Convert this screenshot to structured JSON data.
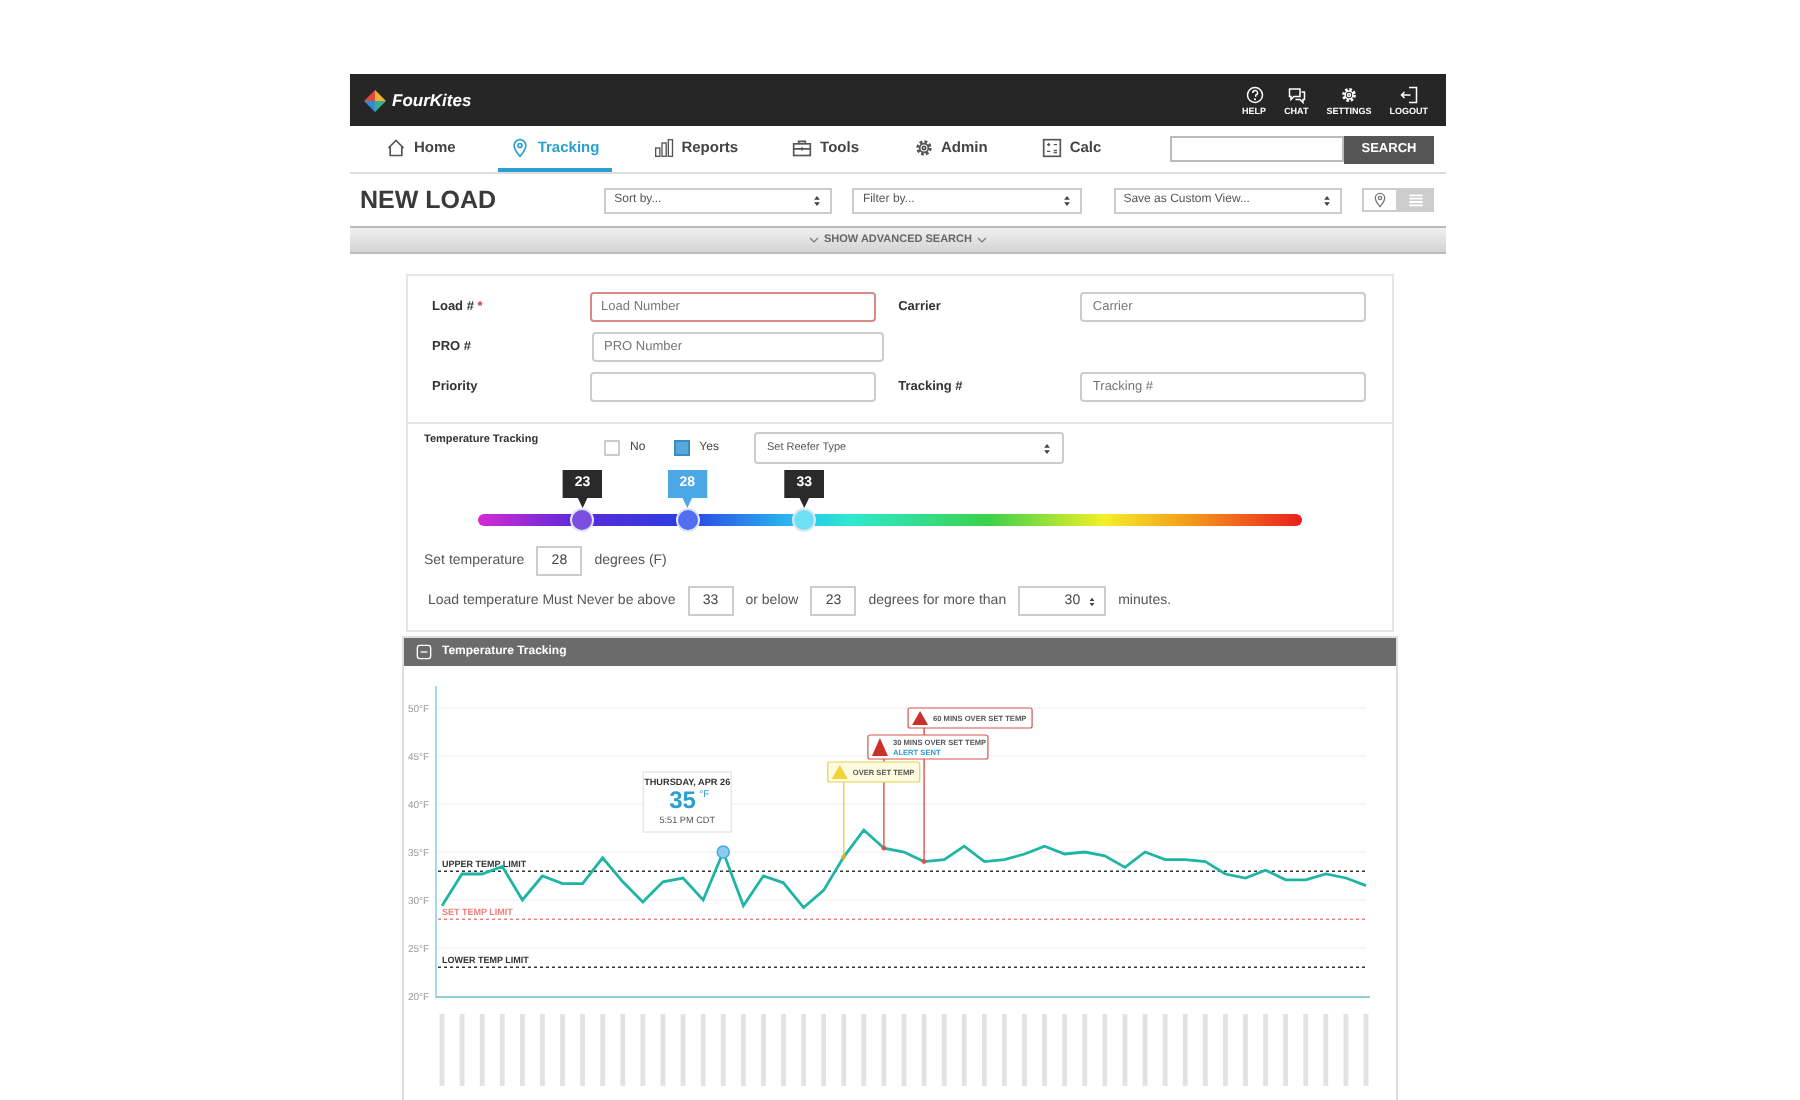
{
  "header": {
    "logo": "FourKites",
    "actions": [
      {
        "label": "HELP"
      },
      {
        "label": "CHAT"
      },
      {
        "label": "SETTINGS"
      },
      {
        "label": "LOGOUT"
      }
    ]
  },
  "nav": {
    "tabs": [
      {
        "label": "Home",
        "selected": false
      },
      {
        "label": "Tracking",
        "selected": true
      },
      {
        "label": "Reports",
        "selected": false
      },
      {
        "label": "Tools",
        "selected": false
      },
      {
        "label": "Admin",
        "selected": false
      },
      {
        "label": "Calc",
        "selected": false
      }
    ],
    "search_button": "SEARCH"
  },
  "toolbar": {
    "title": "NEW LOAD",
    "dropdowns": [
      "Sort by...",
      "Filter by...",
      "Save as Custom View..."
    ],
    "views": [
      {
        "selected": false
      },
      {
        "selected": true
      }
    ]
  },
  "advanced_search": "SHOW ADVANCED SEARCH",
  "form": {
    "rows": [
      [
        {
          "label": "Load #",
          "required_mark": "*",
          "placeholder": "Load Number",
          "invalid": true
        },
        {
          "label": "Carrier",
          "placeholder": "Carrier",
          "invalid": false
        }
      ],
      [
        {
          "label": "PRO #",
          "placeholder": "PRO Number",
          "invalid": false
        }
      ],
      [
        {
          "label": "Priority",
          "invalid": false
        },
        {
          "label": "Tracking #",
          "placeholder": "Tracking #",
          "invalid": false
        }
      ]
    ]
  },
  "temperature": {
    "title": "Temperature Tracking",
    "options": [
      {
        "label": "No",
        "checked": false
      },
      {
        "label": "Yes",
        "checked": true
      }
    ],
    "reefer_select": "Set Reefer Type",
    "thresholds": [
      {
        "value": "23",
        "level": 0.127,
        "selected": false,
        "color": "#7a4fe0"
      },
      {
        "value": "28",
        "level": 0.254,
        "selected": true,
        "color": "#4f6ff0"
      },
      {
        "value": "33",
        "level": 0.396,
        "selected": false,
        "color": "#6fe0f5"
      }
    ],
    "set_temp": {
      "label": "Set temperature",
      "value": "28",
      "unit": "degrees (F)"
    },
    "rule": [
      {
        "kind": "text",
        "text": "Load temperature Must Never be above"
      },
      {
        "kind": "input",
        "text": "33"
      },
      {
        "kind": "text",
        "text": "or below"
      },
      {
        "kind": "input",
        "text": "23"
      },
      {
        "kind": "text",
        "text": "degrees for more than"
      },
      {
        "kind": "spinner",
        "text": "30"
      },
      {
        "kind": "text",
        "text": "minutes."
      }
    ]
  },
  "chart_panel": {
    "title": "Temperature Tracking",
    "alerts": [
      {
        "kind": "warning",
        "label": "OVER SET TEMP"
      },
      {
        "kind": "critical",
        "label": "30 MINS OVER SET TEMP",
        "note": "ALERT SENT"
      },
      {
        "kind": "critical",
        "label": "60 MINS OVER SET TEMP"
      }
    ],
    "tooltip": {
      "title": "THURSDAY, APR 26",
      "value": "35",
      "unit": "°F",
      "time": "5:51 PM CDT"
    },
    "chart_data": {
      "type": "line",
      "grid": true,
      "ylim": [
        20,
        50
      ],
      "yticks": [
        {
          "value": 20,
          "label": "20°F"
        },
        {
          "value": 25,
          "label": "25°F"
        },
        {
          "value": 30,
          "label": "30°F"
        },
        {
          "value": 35,
          "label": "35°F"
        },
        {
          "value": 40,
          "label": "40°F"
        },
        {
          "value": 45,
          "label": "45°F"
        },
        {
          "value": 50,
          "label": "50°F"
        }
      ],
      "series": [
        {
          "color": "#1fb5a5",
          "values": [
            29.4,
            32.7,
            32.7,
            33.5,
            30,
            32.5,
            31.7,
            31.7,
            34.4,
            31.9,
            29.8,
            31.9,
            32.3,
            30,
            35,
            29.4,
            32.5,
            31.8,
            29.2,
            31,
            34.5,
            37.3,
            35.4,
            35,
            34,
            34.2,
            35.6,
            34,
            34.2,
            34.8,
            35.6,
            34.8,
            35,
            34.6,
            33.4,
            35,
            34.2,
            34.2,
            34,
            32.7,
            32.3,
            33.1,
            32.1,
            32.1,
            32.7,
            32.3,
            31.5
          ]
        }
      ],
      "ref_lines": [
        {
          "axis": "y",
          "value": 33,
          "label": "UPPER TEMP LIMIT",
          "color": "#333333"
        },
        {
          "axis": "y",
          "value": 28,
          "label": "SET TEMP LIMIT",
          "color": "#f08080"
        },
        {
          "axis": "y",
          "value": 23,
          "label": "LOWER TEMP LIMIT",
          "color": "#333333"
        }
      ]
    }
  }
}
